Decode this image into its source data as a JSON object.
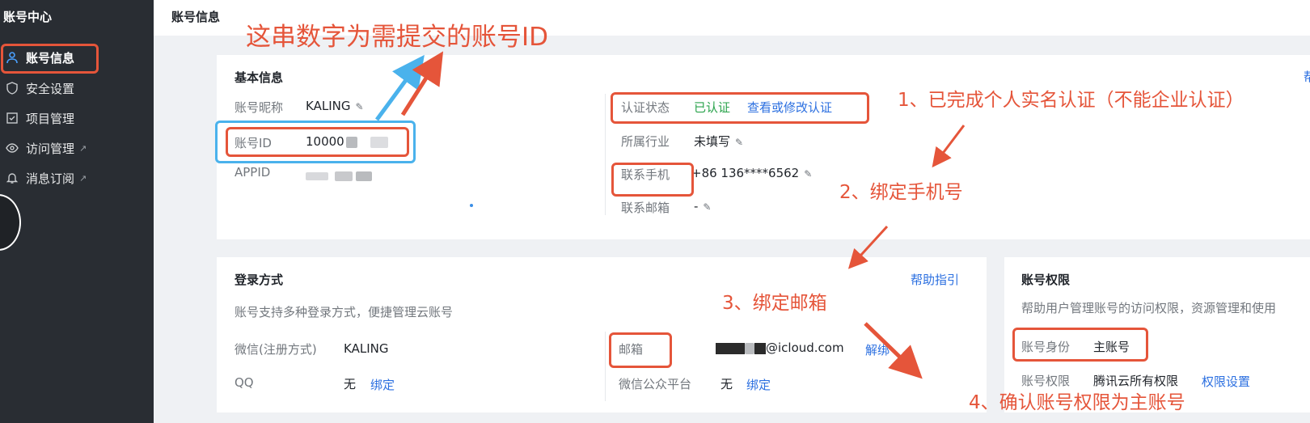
{
  "sidebar": {
    "title": "账号中心",
    "items": [
      {
        "label": "账号信息",
        "icon": "user-icon",
        "external": false
      },
      {
        "label": "安全设置",
        "icon": "shield-icon",
        "external": false
      },
      {
        "label": "项目管理",
        "icon": "checkbox-icon",
        "external": false
      },
      {
        "label": "访问管理",
        "icon": "eye-icon",
        "external": true
      },
      {
        "label": "消息订阅",
        "icon": "bell-icon",
        "external": true
      }
    ]
  },
  "topbar": {
    "title": "账号信息"
  },
  "basic": {
    "title": "基本信息",
    "nickname_label": "账号昵称",
    "nickname": "KALING",
    "id_label": "账号ID",
    "id_prefix": "10000",
    "appid_label": "APPID",
    "auth_label": "认证状态",
    "auth_status": "已认证",
    "auth_link": "查看或修改认证",
    "industry_label": "所属行业",
    "industry": "未填写",
    "phone_label": "联系手机",
    "phone": "+86 136****6562",
    "email_label": "联系邮箱",
    "email": "-",
    "help_partial": "帮"
  },
  "login": {
    "title": "登录方式",
    "desc": "账号支持多种登录方式，便捷管理云账号",
    "help": "帮助指引",
    "wechat_label": "微信(注册方式)",
    "wechat": "KALING",
    "qq_label": "QQ",
    "qq": "无",
    "qq_link": "绑定",
    "mail_label": "邮箱",
    "mail_suffix": "@icloud.com",
    "mail_link": "解绑",
    "mp_label": "微信公众平台",
    "mp": "无",
    "mp_link": "绑定"
  },
  "perm": {
    "title": "账号权限",
    "desc": "帮助用户管理账号的访问权限，资源管理和使用",
    "identity_label": "账号身份",
    "identity": "主账号",
    "perm_label": "账号权限",
    "perm": "腾讯云所有权限",
    "perm_link": "权限设置"
  },
  "annotations": {
    "id_note": "这串数字为需提交的账号ID",
    "step1": "1、已完成个人实名认证（不能企业认证）",
    "step2": "2、绑定手机号",
    "step3": "3、绑定邮箱",
    "step4": "4、确认账号权限为主账号"
  },
  "colors": {
    "annotation": "#e5553a",
    "highlight_blue": "#4ab2ec",
    "link": "#2b6fe0",
    "verified": "#29a34b",
    "sidebar": "#292d33"
  }
}
